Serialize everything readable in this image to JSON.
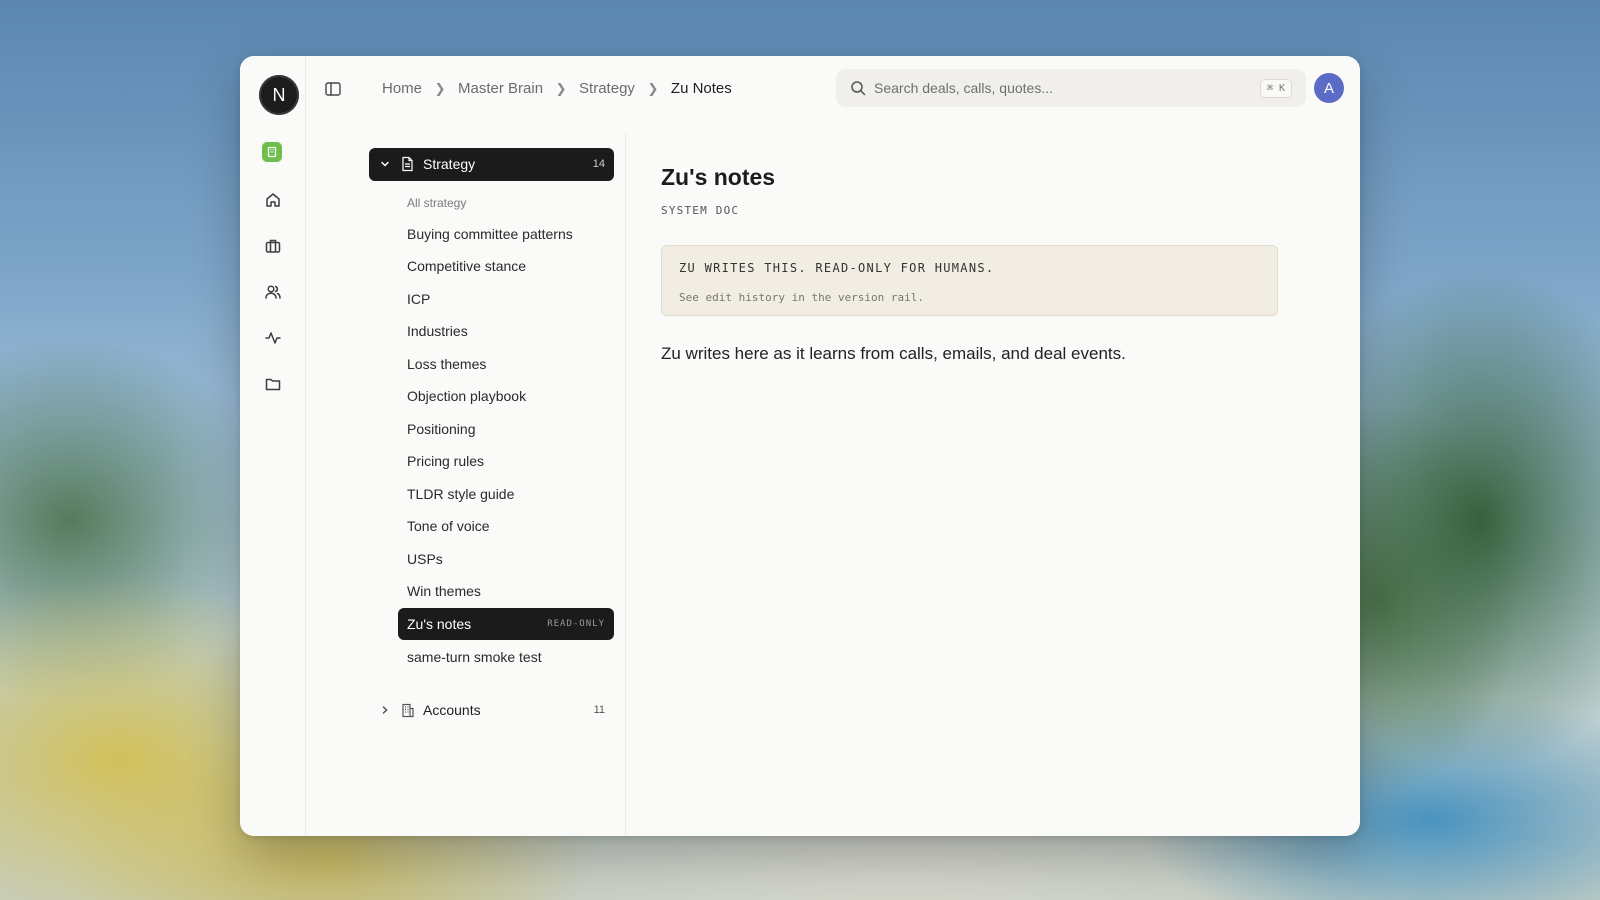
{
  "topbar": {
    "breadcrumbs": [
      "Home",
      "Master Brain",
      "Strategy",
      "Zu Notes"
    ],
    "search_placeholder": "Search deals, calls, quotes...",
    "search_shortcut": "⌘ K",
    "avatar_initial": "A"
  },
  "rail": {
    "logo_letter": "N",
    "icons": [
      "workspace-badge",
      "home-icon",
      "briefcase-icon",
      "users-icon",
      "activity-icon",
      "folder-icon"
    ]
  },
  "tree": {
    "strategy": {
      "label": "Strategy",
      "count": "14"
    },
    "items": [
      "All strategy",
      "Buying committee patterns",
      "Competitive stance",
      "ICP",
      "Industries",
      "Loss themes",
      "Objection playbook",
      "Positioning",
      "Pricing rules",
      "TLDR style guide",
      "Tone of voice",
      "USPs",
      "Win themes",
      "Zu's notes",
      "same-turn smoke test"
    ],
    "active_item": "Zu's notes",
    "active_tag": "READ-ONLY",
    "accounts": {
      "label": "Accounts",
      "count": "11"
    }
  },
  "doc": {
    "title": "Zu's notes",
    "kind": "SYSTEM DOC",
    "notice_title": "ZU WRITES THIS. READ-ONLY FOR HUMANS.",
    "notice_sub": "See edit history in the version rail.",
    "body": "Zu writes here as it learns from calls, emails, and deal events."
  }
}
